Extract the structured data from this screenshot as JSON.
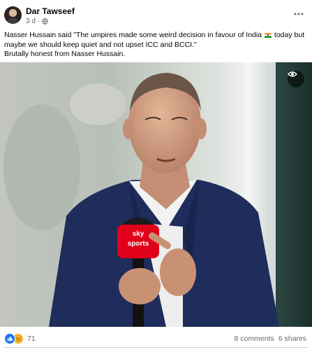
{
  "post": {
    "author": "Dar Tawseef",
    "time": "3 d",
    "time_separator": "·",
    "text_line1_pre": "Nasser Hussain said \"The umpires made some weird decision in favour of India ",
    "text_line1_post": " today but maybe we should keep quiet and not upset ICC and BCCI.\"",
    "text_line2": "Brutally honest from Nasser Hussain.",
    "reaction_count": "71",
    "comments": "8 comments",
    "shares": "6 shares",
    "more_icon": "more-horizontal-icon",
    "flag_icon": "india-flag-emoji",
    "image_overlay_icon": "eye-icon",
    "mic_text": "sky sports",
    "colors": {
      "like": "#1877f2",
      "sad": "#f7b125",
      "secondary_text": "#65676b",
      "mic_flag": "#e10019",
      "jacket": "#1f2d5c"
    }
  }
}
